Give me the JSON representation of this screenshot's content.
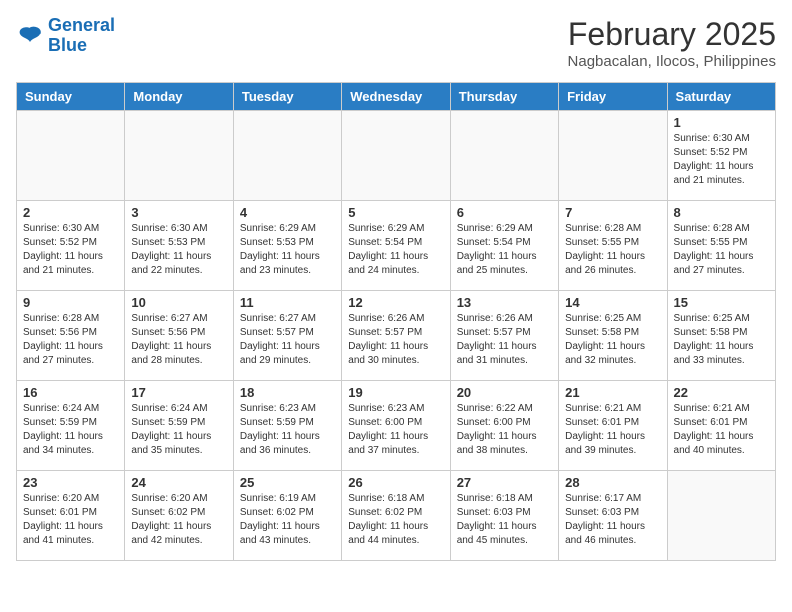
{
  "header": {
    "logo_line1": "General",
    "logo_line2": "Blue",
    "month_title": "February 2025",
    "subtitle": "Nagbacalan, Ilocos, Philippines"
  },
  "weekdays": [
    "Sunday",
    "Monday",
    "Tuesday",
    "Wednesday",
    "Thursday",
    "Friday",
    "Saturday"
  ],
  "weeks": [
    [
      {
        "day": "",
        "info": ""
      },
      {
        "day": "",
        "info": ""
      },
      {
        "day": "",
        "info": ""
      },
      {
        "day": "",
        "info": ""
      },
      {
        "day": "",
        "info": ""
      },
      {
        "day": "",
        "info": ""
      },
      {
        "day": "1",
        "info": "Sunrise: 6:30 AM\nSunset: 5:52 PM\nDaylight: 11 hours and 21 minutes."
      }
    ],
    [
      {
        "day": "2",
        "info": "Sunrise: 6:30 AM\nSunset: 5:52 PM\nDaylight: 11 hours and 21 minutes."
      },
      {
        "day": "3",
        "info": "Sunrise: 6:30 AM\nSunset: 5:53 PM\nDaylight: 11 hours and 22 minutes."
      },
      {
        "day": "4",
        "info": "Sunrise: 6:29 AM\nSunset: 5:53 PM\nDaylight: 11 hours and 23 minutes."
      },
      {
        "day": "5",
        "info": "Sunrise: 6:29 AM\nSunset: 5:54 PM\nDaylight: 11 hours and 24 minutes."
      },
      {
        "day": "6",
        "info": "Sunrise: 6:29 AM\nSunset: 5:54 PM\nDaylight: 11 hours and 25 minutes."
      },
      {
        "day": "7",
        "info": "Sunrise: 6:28 AM\nSunset: 5:55 PM\nDaylight: 11 hours and 26 minutes."
      },
      {
        "day": "8",
        "info": "Sunrise: 6:28 AM\nSunset: 5:55 PM\nDaylight: 11 hours and 27 minutes."
      }
    ],
    [
      {
        "day": "9",
        "info": "Sunrise: 6:28 AM\nSunset: 5:56 PM\nDaylight: 11 hours and 27 minutes."
      },
      {
        "day": "10",
        "info": "Sunrise: 6:27 AM\nSunset: 5:56 PM\nDaylight: 11 hours and 28 minutes."
      },
      {
        "day": "11",
        "info": "Sunrise: 6:27 AM\nSunset: 5:57 PM\nDaylight: 11 hours and 29 minutes."
      },
      {
        "day": "12",
        "info": "Sunrise: 6:26 AM\nSunset: 5:57 PM\nDaylight: 11 hours and 30 minutes."
      },
      {
        "day": "13",
        "info": "Sunrise: 6:26 AM\nSunset: 5:57 PM\nDaylight: 11 hours and 31 minutes."
      },
      {
        "day": "14",
        "info": "Sunrise: 6:25 AM\nSunset: 5:58 PM\nDaylight: 11 hours and 32 minutes."
      },
      {
        "day": "15",
        "info": "Sunrise: 6:25 AM\nSunset: 5:58 PM\nDaylight: 11 hours and 33 minutes."
      }
    ],
    [
      {
        "day": "16",
        "info": "Sunrise: 6:24 AM\nSunset: 5:59 PM\nDaylight: 11 hours and 34 minutes."
      },
      {
        "day": "17",
        "info": "Sunrise: 6:24 AM\nSunset: 5:59 PM\nDaylight: 11 hours and 35 minutes."
      },
      {
        "day": "18",
        "info": "Sunrise: 6:23 AM\nSunset: 5:59 PM\nDaylight: 11 hours and 36 minutes."
      },
      {
        "day": "19",
        "info": "Sunrise: 6:23 AM\nSunset: 6:00 PM\nDaylight: 11 hours and 37 minutes."
      },
      {
        "day": "20",
        "info": "Sunrise: 6:22 AM\nSunset: 6:00 PM\nDaylight: 11 hours and 38 minutes."
      },
      {
        "day": "21",
        "info": "Sunrise: 6:21 AM\nSunset: 6:01 PM\nDaylight: 11 hours and 39 minutes."
      },
      {
        "day": "22",
        "info": "Sunrise: 6:21 AM\nSunset: 6:01 PM\nDaylight: 11 hours and 40 minutes."
      }
    ],
    [
      {
        "day": "23",
        "info": "Sunrise: 6:20 AM\nSunset: 6:01 PM\nDaylight: 11 hours and 41 minutes."
      },
      {
        "day": "24",
        "info": "Sunrise: 6:20 AM\nSunset: 6:02 PM\nDaylight: 11 hours and 42 minutes."
      },
      {
        "day": "25",
        "info": "Sunrise: 6:19 AM\nSunset: 6:02 PM\nDaylight: 11 hours and 43 minutes."
      },
      {
        "day": "26",
        "info": "Sunrise: 6:18 AM\nSunset: 6:02 PM\nDaylight: 11 hours and 44 minutes."
      },
      {
        "day": "27",
        "info": "Sunrise: 6:18 AM\nSunset: 6:03 PM\nDaylight: 11 hours and 45 minutes."
      },
      {
        "day": "28",
        "info": "Sunrise: 6:17 AM\nSunset: 6:03 PM\nDaylight: 11 hours and 46 minutes."
      },
      {
        "day": "",
        "info": ""
      }
    ]
  ]
}
